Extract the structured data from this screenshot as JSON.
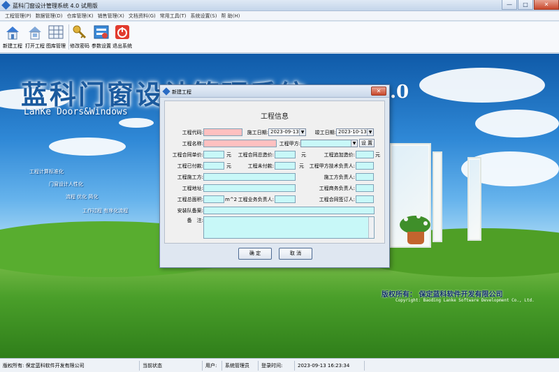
{
  "app": {
    "title": "蓝科门窗设计管理系统 4.0 试用版",
    "window_controls": {
      "minimize": "—",
      "maximize": "□",
      "close": "✕"
    }
  },
  "menu": [
    "工程管理(P)",
    "数据管理(D)",
    "仓库管理(K)",
    "销售管理(X)",
    "文档资料(G)",
    "常用工具(T)",
    "系统设置(S)",
    "帮 助(H)"
  ],
  "toolbar": [
    {
      "label": "新建工程",
      "icon": "new-project-icon"
    },
    {
      "label": "打开工程",
      "icon": "open-project-icon"
    },
    {
      "label": "图库管理",
      "icon": "gallery-icon"
    },
    {
      "label": "修改密码",
      "icon": "key-icon"
    },
    {
      "label": "参数设置",
      "icon": "settings-icon"
    },
    {
      "label": "退出系统",
      "icon": "power-icon"
    }
  ],
  "splash": {
    "title_cn": "蓝科门窗设计管理系统",
    "title_en": "LanKe Doors&Windows",
    "version_glyphs": ".0",
    "features": [
      "工程计算标准化",
      "门窗设计人性化",
      "流程 优化 简化",
      "工作过程 有序化流程"
    ],
    "copyright_cn": "版权所有：  保定蓝科软件开发有限公司",
    "copyright_en": "Copyright: Baoding Lanke Software Development Co., Ltd."
  },
  "dialog": {
    "title": "新建工程",
    "close": "✕",
    "heading": "工程信息",
    "labels": {
      "code": "工程代码:",
      "start_date": "施工日期:",
      "end_date": "竣工日期:",
      "name": "工程名称:",
      "client": "工程甲方:",
      "unit_price": "工程合同单价:",
      "total_price": "工程合同总造价:",
      "extra_price": "工程追加造价:",
      "paid": "工程已付款:",
      "unpaid": "工程未付款:",
      "client_tech": "工程甲方技术负责人:",
      "builder": "工程施工方:",
      "builder_lead": "施工方负责人:",
      "address": "工程地址:",
      "biz_lead": "工程商务负责人:",
      "area": "工程总面积:",
      "sales_lead": "工程业务负责人:",
      "signer": "工程合同签订人:",
      "install_team": "安装队备案:",
      "notes": "备　注:"
    },
    "values": {
      "start_date": "2023-09-13",
      "end_date": "2023-10-13"
    },
    "units": {
      "currency": "元",
      "area": "m^2"
    },
    "set_button": "设 置",
    "ok": "确 定",
    "cancel": "取 消"
  },
  "status": {
    "copyright": "版权所有:  保定蓝科软件开发有限公司",
    "state_label": "当前状态",
    "user_label": "用户:",
    "user": "系统管理员",
    "login_label": "登录时间:",
    "login_time": "2023-09-13  16:23:34"
  }
}
